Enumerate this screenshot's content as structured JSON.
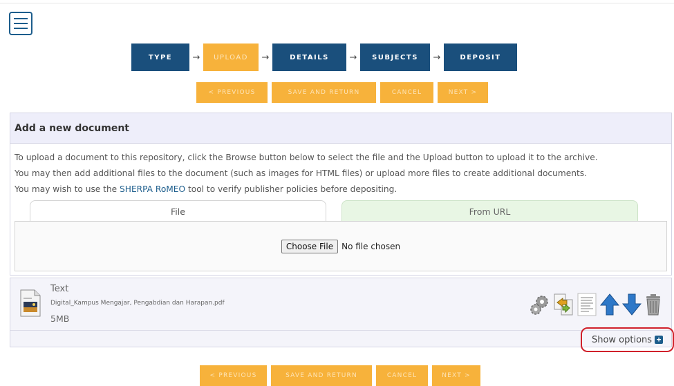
{
  "steps": [
    {
      "label": "TYPE"
    },
    {
      "label": "UPLOAD"
    },
    {
      "label": "DETAILS"
    },
    {
      "label": "SUBJECTS"
    },
    {
      "label": "DEPOSIT"
    }
  ],
  "step_arrow": "→",
  "nav_buttons": {
    "previous": "< PREVIOUS",
    "save_return": "SAVE AND RETURN",
    "cancel": "CANCEL",
    "next": "NEXT >"
  },
  "panel": {
    "title": "Add a new document",
    "intro_line1": "To upload a document to this repository, click the Browse button below to select the file and the Upload button to upload it to the archive.",
    "intro_line2": "You may then add additional files to the document (such as images for HTML files) or upload more files to create additional documents.",
    "intro_line3_pre": "You may wish to use the ",
    "intro_link": "SHERPA RoMEO",
    "intro_line3_post": " tool to verify publisher policies before depositing.",
    "tabs": {
      "file": "File",
      "url": "From URL"
    },
    "choose_file": "Choose File",
    "no_file": "No file chosen"
  },
  "document": {
    "type": "Text",
    "filename": "Digital_Kampus Mengajar, Pengabdian dan Harapan.pdf",
    "size": "5MB",
    "actions": [
      "gear-icon",
      "convert-icon",
      "text-doc-icon",
      "arrow-up-icon",
      "arrow-down-icon",
      "trash-icon"
    ]
  },
  "show_options": "Show options",
  "colors": {
    "step_blue": "#1a4f7c",
    "step_active": "#f7b23b",
    "button_orange": "#f7b23b",
    "link": "#1c5d8c",
    "highlight_red": "#d0202a"
  }
}
